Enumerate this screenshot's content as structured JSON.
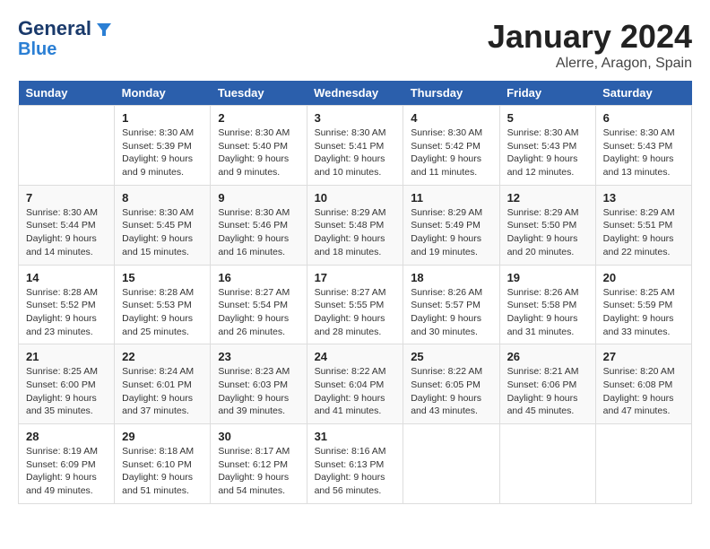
{
  "header": {
    "logo_line1": "General",
    "logo_line2": "Blue",
    "month": "January 2024",
    "location": "Alerre, Aragon, Spain"
  },
  "days_of_week": [
    "Sunday",
    "Monday",
    "Tuesday",
    "Wednesday",
    "Thursday",
    "Friday",
    "Saturday"
  ],
  "weeks": [
    [
      {
        "day": "",
        "info": ""
      },
      {
        "day": "1",
        "info": "Sunrise: 8:30 AM\nSunset: 5:39 PM\nDaylight: 9 hours\nand 9 minutes."
      },
      {
        "day": "2",
        "info": "Sunrise: 8:30 AM\nSunset: 5:40 PM\nDaylight: 9 hours\nand 9 minutes."
      },
      {
        "day": "3",
        "info": "Sunrise: 8:30 AM\nSunset: 5:41 PM\nDaylight: 9 hours\nand 10 minutes."
      },
      {
        "day": "4",
        "info": "Sunrise: 8:30 AM\nSunset: 5:42 PM\nDaylight: 9 hours\nand 11 minutes."
      },
      {
        "day": "5",
        "info": "Sunrise: 8:30 AM\nSunset: 5:43 PM\nDaylight: 9 hours\nand 12 minutes."
      },
      {
        "day": "6",
        "info": "Sunrise: 8:30 AM\nSunset: 5:43 PM\nDaylight: 9 hours\nand 13 minutes."
      }
    ],
    [
      {
        "day": "7",
        "info": "Sunrise: 8:30 AM\nSunset: 5:44 PM\nDaylight: 9 hours\nand 14 minutes."
      },
      {
        "day": "8",
        "info": "Sunrise: 8:30 AM\nSunset: 5:45 PM\nDaylight: 9 hours\nand 15 minutes."
      },
      {
        "day": "9",
        "info": "Sunrise: 8:30 AM\nSunset: 5:46 PM\nDaylight: 9 hours\nand 16 minutes."
      },
      {
        "day": "10",
        "info": "Sunrise: 8:29 AM\nSunset: 5:48 PM\nDaylight: 9 hours\nand 18 minutes."
      },
      {
        "day": "11",
        "info": "Sunrise: 8:29 AM\nSunset: 5:49 PM\nDaylight: 9 hours\nand 19 minutes."
      },
      {
        "day": "12",
        "info": "Sunrise: 8:29 AM\nSunset: 5:50 PM\nDaylight: 9 hours\nand 20 minutes."
      },
      {
        "day": "13",
        "info": "Sunrise: 8:29 AM\nSunset: 5:51 PM\nDaylight: 9 hours\nand 22 minutes."
      }
    ],
    [
      {
        "day": "14",
        "info": "Sunrise: 8:28 AM\nSunset: 5:52 PM\nDaylight: 9 hours\nand 23 minutes."
      },
      {
        "day": "15",
        "info": "Sunrise: 8:28 AM\nSunset: 5:53 PM\nDaylight: 9 hours\nand 25 minutes."
      },
      {
        "day": "16",
        "info": "Sunrise: 8:27 AM\nSunset: 5:54 PM\nDaylight: 9 hours\nand 26 minutes."
      },
      {
        "day": "17",
        "info": "Sunrise: 8:27 AM\nSunset: 5:55 PM\nDaylight: 9 hours\nand 28 minutes."
      },
      {
        "day": "18",
        "info": "Sunrise: 8:26 AM\nSunset: 5:57 PM\nDaylight: 9 hours\nand 30 minutes."
      },
      {
        "day": "19",
        "info": "Sunrise: 8:26 AM\nSunset: 5:58 PM\nDaylight: 9 hours\nand 31 minutes."
      },
      {
        "day": "20",
        "info": "Sunrise: 8:25 AM\nSunset: 5:59 PM\nDaylight: 9 hours\nand 33 minutes."
      }
    ],
    [
      {
        "day": "21",
        "info": "Sunrise: 8:25 AM\nSunset: 6:00 PM\nDaylight: 9 hours\nand 35 minutes."
      },
      {
        "day": "22",
        "info": "Sunrise: 8:24 AM\nSunset: 6:01 PM\nDaylight: 9 hours\nand 37 minutes."
      },
      {
        "day": "23",
        "info": "Sunrise: 8:23 AM\nSunset: 6:03 PM\nDaylight: 9 hours\nand 39 minutes."
      },
      {
        "day": "24",
        "info": "Sunrise: 8:22 AM\nSunset: 6:04 PM\nDaylight: 9 hours\nand 41 minutes."
      },
      {
        "day": "25",
        "info": "Sunrise: 8:22 AM\nSunset: 6:05 PM\nDaylight: 9 hours\nand 43 minutes."
      },
      {
        "day": "26",
        "info": "Sunrise: 8:21 AM\nSunset: 6:06 PM\nDaylight: 9 hours\nand 45 minutes."
      },
      {
        "day": "27",
        "info": "Sunrise: 8:20 AM\nSunset: 6:08 PM\nDaylight: 9 hours\nand 47 minutes."
      }
    ],
    [
      {
        "day": "28",
        "info": "Sunrise: 8:19 AM\nSunset: 6:09 PM\nDaylight: 9 hours\nand 49 minutes."
      },
      {
        "day": "29",
        "info": "Sunrise: 8:18 AM\nSunset: 6:10 PM\nDaylight: 9 hours\nand 51 minutes."
      },
      {
        "day": "30",
        "info": "Sunrise: 8:17 AM\nSunset: 6:12 PM\nDaylight: 9 hours\nand 54 minutes."
      },
      {
        "day": "31",
        "info": "Sunrise: 8:16 AM\nSunset: 6:13 PM\nDaylight: 9 hours\nand 56 minutes."
      },
      {
        "day": "",
        "info": ""
      },
      {
        "day": "",
        "info": ""
      },
      {
        "day": "",
        "info": ""
      }
    ]
  ]
}
